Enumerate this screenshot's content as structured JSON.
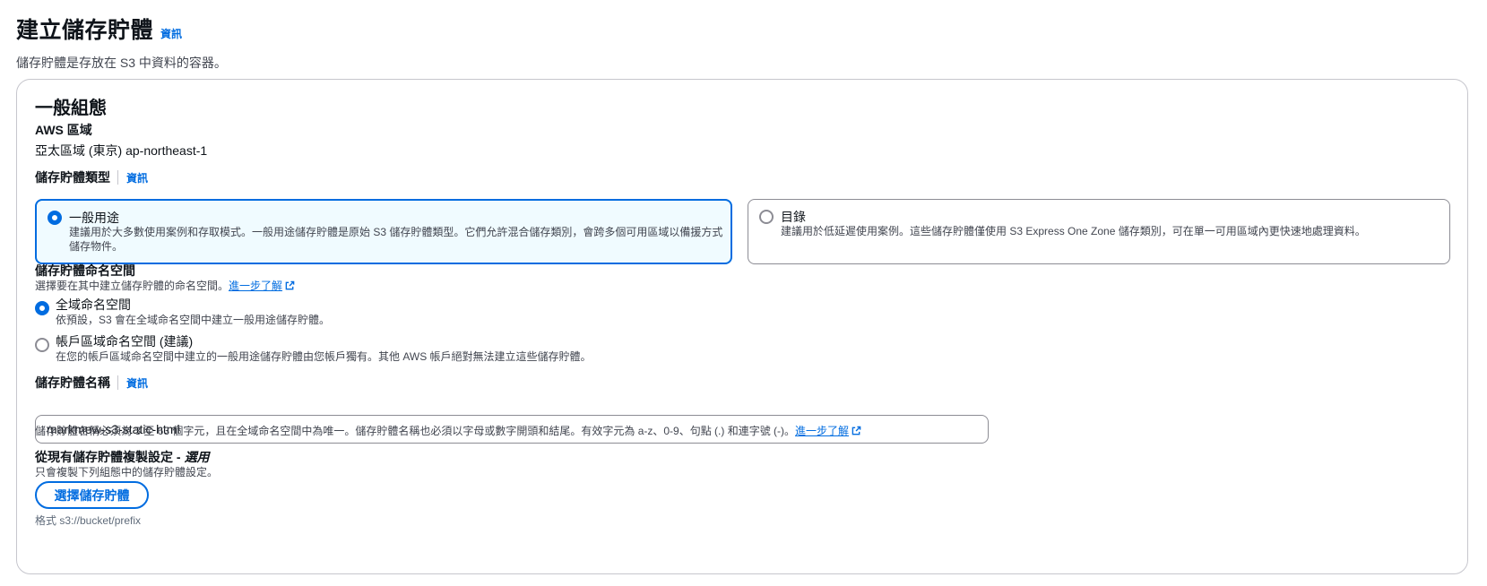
{
  "header": {
    "title": "建立儲存貯體",
    "info": "資訊",
    "subtitle": "儲存貯體是存放在 S3 中資料的容器。"
  },
  "general": {
    "title": "一般組態",
    "region_label": "AWS 區域",
    "region_value": "亞太區域 (東京) ap-northeast-1",
    "bucket_type_label": "儲存貯體類型",
    "bucket_type_info": "資訊",
    "bucket_types": [
      {
        "label": "一般用途",
        "description": "建議用於大多數使用案例和存取模式。一般用途儲存貯體是原始 S3 儲存貯體類型。它們允許混合儲存類別，會跨多個可用區域以備援方式儲存物件。",
        "selected": true
      },
      {
        "label": "目錄",
        "description": "建議用於低延遲使用案例。這些儲存貯體僅使用 S3 Express One Zone 儲存類別，可在單一可用區域內更快速地處理資料。",
        "selected": false
      }
    ],
    "namespace_label": "儲存貯體命名空間",
    "namespace_description": "選擇要在其中建立儲存貯體的命名空間。",
    "namespace_learn_more": "進一步了解",
    "namespace_options": [
      {
        "label": "全域命名空間",
        "description": "依預設，S3 會在全域命名空間中建立一般用途儲存貯體。",
        "selected": true
      },
      {
        "label": "帳戶區域命名空間 (建議)",
        "description": "在您的帳戶區域命名空間中建立的一般用途儲存貯體由您帳戶獨有。其他 AWS 帳戶絕對無法建立這些儲存貯體。",
        "selected": false
      }
    ],
    "bucket_name_label": "儲存貯體名稱",
    "bucket_name_info": "資訊",
    "bucket_name_value": "markmew-s3-static-html",
    "bucket_name_constraint": "儲存貯體名稱必須為 3 至 63 個字元，且在全域命名空間中為唯一。儲存貯體名稱也必須以字母或數字開頭和結尾。有效字元為 a-z、0-9、句點 (.) 和連字號 (-)。",
    "bucket_name_learn_more": "進一步了解",
    "copy_settings_label": "從現有儲存貯體複製設定 - ",
    "copy_settings_optional": "選用",
    "copy_settings_description": "只會複製下列組態中的儲存貯體設定。",
    "choose_bucket_button": "選擇儲存貯體",
    "format_hint": "格式 s3://bucket/prefix"
  },
  "colors": {
    "accent": "#006ce0",
    "selected_tile_bg": "#f0fbff",
    "text": "#0f141a",
    "secondary_text": "#424650",
    "border": "#c6c6cd"
  },
  "icons": {
    "external_link": "external-link-icon"
  }
}
